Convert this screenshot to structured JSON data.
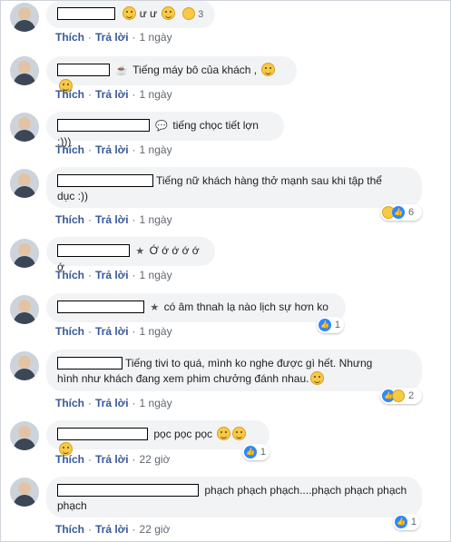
{
  "actions": {
    "like_label": "Thích",
    "reply_label": "Trả lời"
  },
  "comments": [
    {
      "text": "ư ư",
      "time": "1 ngày",
      "reaction_count": "3"
    },
    {
      "text": "Tiếng máy bô của khách ,",
      "time": "1 ngày"
    },
    {
      "text": "tiếng chọc tiết lợn :)))",
      "time": "1 ngày"
    },
    {
      "text_line1": "Tiếng nữ khách hàng thở mạnh sau khi tập thể",
      "text_line2": "dục :))",
      "time": "1 ngày",
      "reaction_count": "6"
    },
    {
      "text": "Ớ ớ ớ ớ ớ ớ",
      "time": "1 ngày"
    },
    {
      "text": "có âm thnah lạ nào lịch sự hơn ko",
      "time": "1 ngày",
      "reaction_count": "1"
    },
    {
      "text_line1": "Tiếng tivi to quá, mình ko nghe được gì hết. Nhưng",
      "text_line2": "hình như khách đang xem phim chưởng đánh nhau.",
      "time": "1 ngày",
      "reaction_count": "2"
    },
    {
      "text": "pọc pọc pọc",
      "time": "22 giờ",
      "reaction_count": "1"
    },
    {
      "text_line1": "phạch phạch phạch....phạch phạch phạch",
      "text_line2": "phạch",
      "time": "22 giờ",
      "reaction_count": "1"
    }
  ],
  "icons": {
    "like": "like-reaction-icon",
    "haha": "haha-reaction-icon",
    "emoji": "smiley-emoji-icon"
  }
}
